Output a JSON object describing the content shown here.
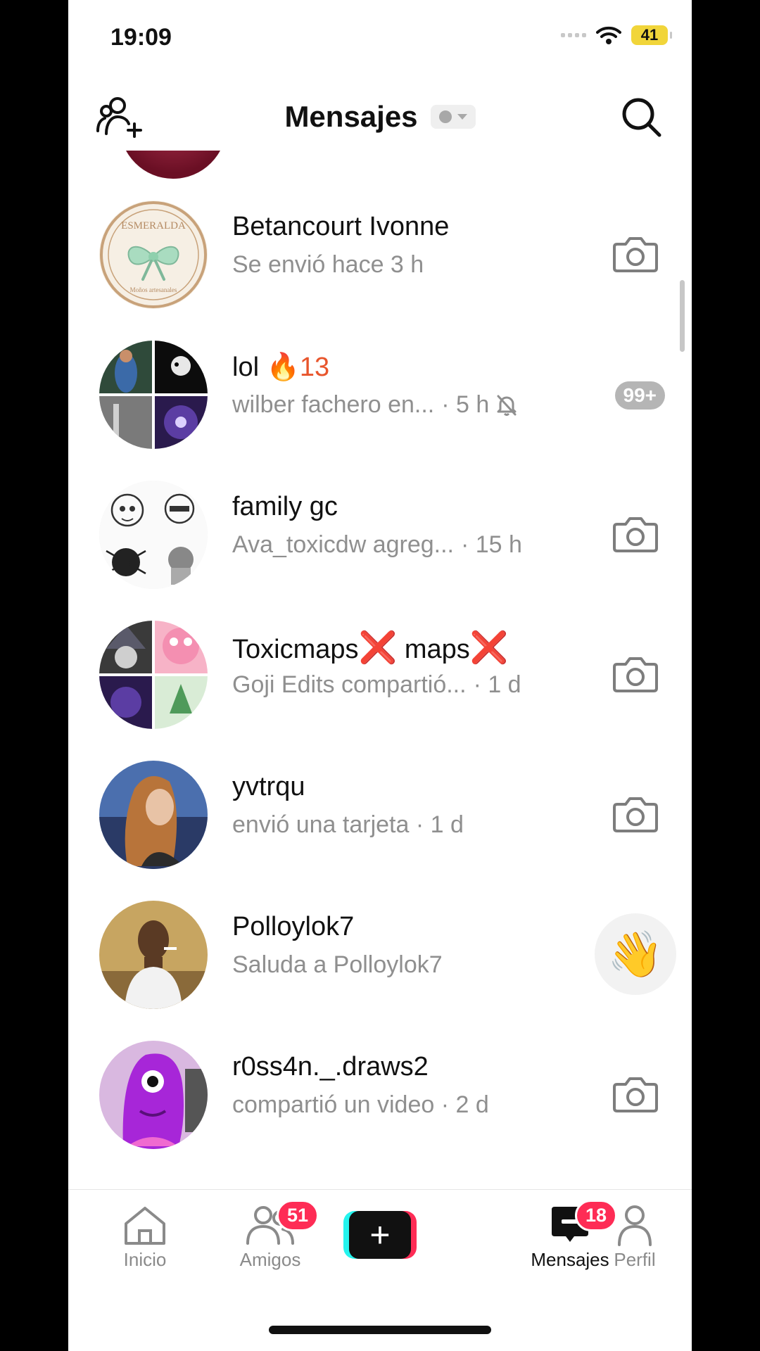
{
  "status_bar": {
    "time": "19:09",
    "battery": "41"
  },
  "header": {
    "title": "Mensajes"
  },
  "chats": [
    {
      "name": "Betancourt Ivonne",
      "name_suffix": "",
      "subtitle": "Se envió hace 3 h",
      "time": "",
      "action": "camera"
    },
    {
      "name": "lol ",
      "name_suffix": "🔥13",
      "subtitle": "wilber fachero en...",
      "time": "· 5 h",
      "action": "badge",
      "badge": "99+",
      "muted": true
    },
    {
      "name": "family gc",
      "name_suffix": "",
      "subtitle": "Ava_toxicdw agreg...",
      "time": "· 15 h",
      "action": "camera"
    },
    {
      "name": "Toxicmaps",
      "name_x1": "❌",
      "name_mid": " maps",
      "name_x2": "❌",
      "subtitle": "Goji Edits compartió...",
      "time": "· 1 d",
      "action": "camera"
    },
    {
      "name": "yvtrqu",
      "name_suffix": "",
      "subtitle": "envió una tarjeta · 1 d",
      "time": "",
      "action": "camera"
    },
    {
      "name": "Polloylok7",
      "name_suffix": "",
      "subtitle": "Saluda a Polloylok7",
      "time": "",
      "action": "wave",
      "wave_icon": "👋"
    },
    {
      "name": "r0ss4n._.draws2",
      "name_suffix": "",
      "subtitle": "compartió un video · 2 d",
      "time": "",
      "action": "camera"
    }
  ],
  "avatar_logo_text": {
    "top": "ESMERALDA",
    "bottom": "Moños artesanales"
  },
  "tabbar": {
    "inicio": "Inicio",
    "amigos": "Amigos",
    "amigos_badge": "51",
    "create": "+",
    "mensajes": "Mensajes",
    "mensajes_badge": "18",
    "perfil": "Perfil"
  },
  "colors": {
    "accent": "#fe2c55",
    "cyan": "#25f4ee",
    "streak": "#e8552c",
    "muted_text": "#8f8f8f"
  }
}
